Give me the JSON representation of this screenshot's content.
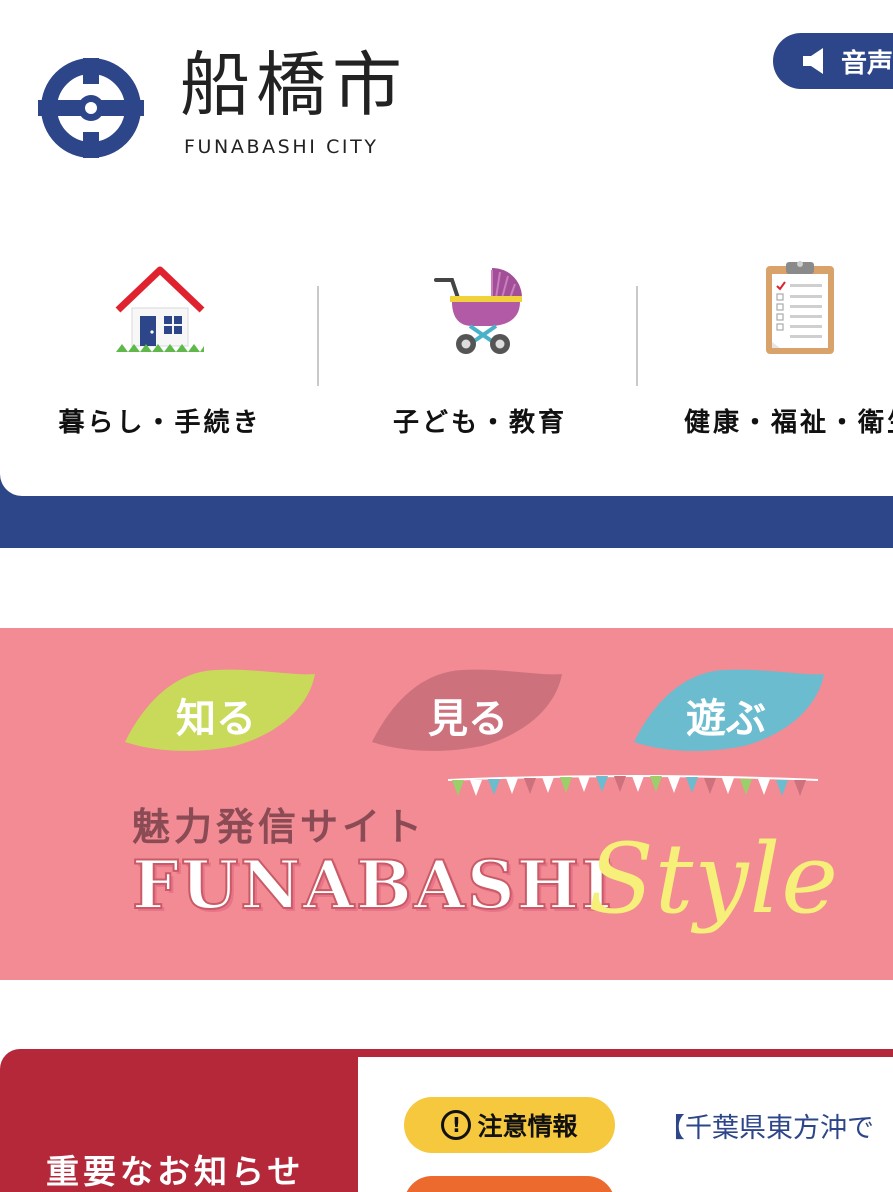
{
  "header": {
    "brand_title": "船橋市",
    "brand_subtitle": "FUNABASHI CITY",
    "voice_button_label": "音声",
    "logo_icon": "city-emblem-icon"
  },
  "categories": [
    {
      "label": "暮らし・手続き",
      "icon": "house-icon"
    },
    {
      "label": "子ども・教育",
      "icon": "stroller-icon"
    },
    {
      "label": "健康・福祉・衛生",
      "icon": "clipboard-icon"
    }
  ],
  "banner": {
    "tag1": "知る",
    "tag2": "見る",
    "tag3": "遊ぶ",
    "subtitle": "魅力発信サイト",
    "title_main": "FUNABASHI",
    "title_script": "Style"
  },
  "notice": {
    "title": "重要なお知らせ",
    "badge_label": "注意情報",
    "badge_symbol": "!",
    "first_item": "【千葉県東方沖で"
  },
  "colors": {
    "navy": "#2d4589",
    "banner_pink": "#f28b94",
    "notice_red": "#b5283a",
    "badge_yellow": "#f6c83e",
    "badge_orange": "#ec6a2d"
  }
}
